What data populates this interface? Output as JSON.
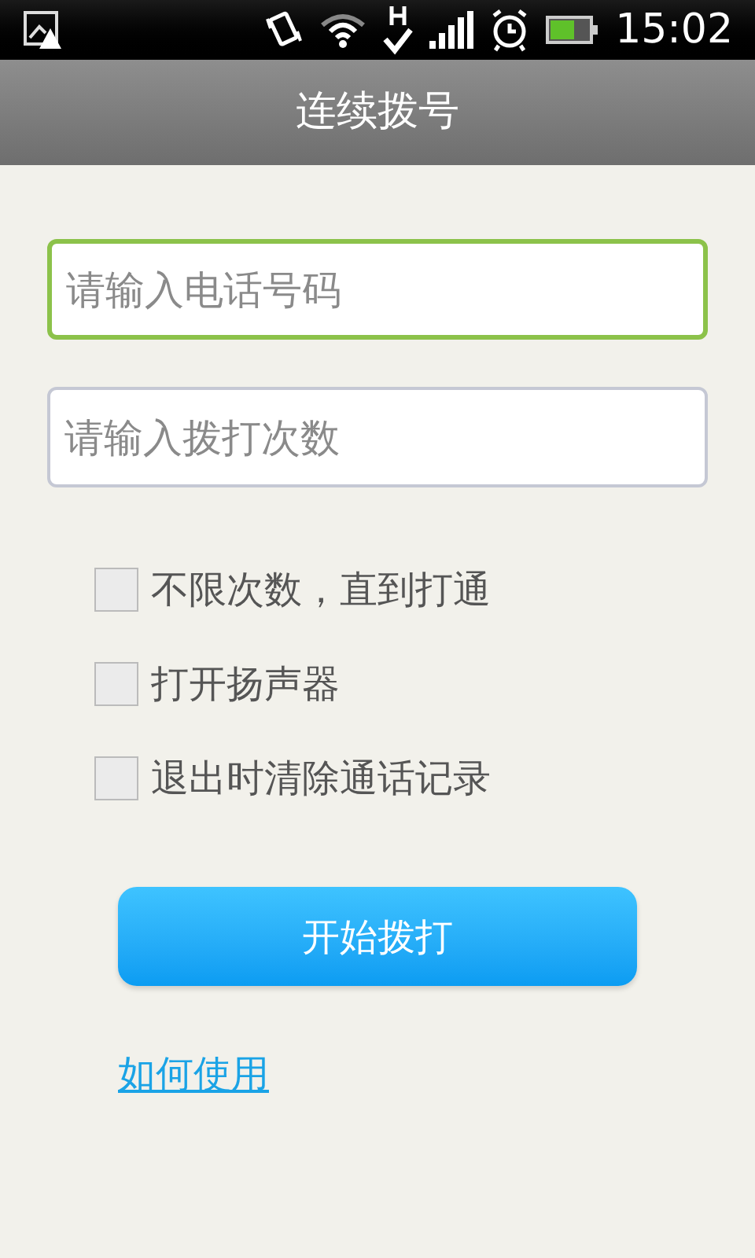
{
  "status_bar": {
    "time": "15:02"
  },
  "title_bar": {
    "title": "连续拨号"
  },
  "fields": [
    {
      "placeholder": "请输入电话号码",
      "focused": true
    },
    {
      "placeholder": "请输入拨打次数",
      "focused": false
    }
  ],
  "options": [
    {
      "label": "不限次数，直到打通",
      "checked": false
    },
    {
      "label": "打开扬声器",
      "checked": false
    },
    {
      "label": "退出时清除通话记录",
      "checked": false
    }
  ],
  "start_button": {
    "label": "开始拨打"
  },
  "help_link": {
    "label": "如何使用"
  }
}
